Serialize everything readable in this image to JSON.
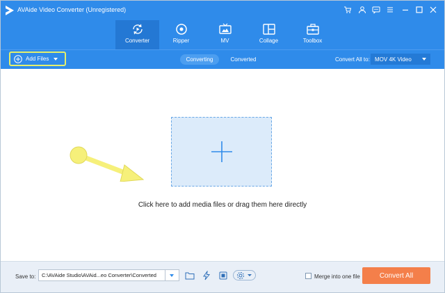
{
  "window": {
    "title": "AVAide Video Converter (Unregistered)",
    "accent_color": "#2f8bea",
    "controls": [
      "cart-icon",
      "user-icon",
      "feedback-icon",
      "menu-icon",
      "minimize-icon",
      "maximize-icon",
      "close-icon"
    ]
  },
  "tabs": [
    {
      "label": "Converter",
      "icon": "converter-icon",
      "active": true
    },
    {
      "label": "Ripper",
      "icon": "ripper-disc-icon",
      "active": false
    },
    {
      "label": "MV",
      "icon": "mv-tv-icon",
      "active": false
    },
    {
      "label": "Collage",
      "icon": "collage-grid-icon",
      "active": false
    },
    {
      "label": "Toolbox",
      "icon": "toolbox-icon",
      "active": false
    }
  ],
  "toolbar": {
    "add_files_label": "Add Files",
    "segments": [
      {
        "label": "Converting",
        "active": true
      },
      {
        "label": "Converted",
        "active": false
      }
    ],
    "convert_all_label": "Convert All to:",
    "format_value": "MOV 4K Video"
  },
  "main": {
    "drop_hint": "Click here to add media files or drag them here directly"
  },
  "bottom": {
    "save_to_label": "Save to:",
    "save_path": "C:\\AVAide Studio\\AVAid...eo Converter\\Converted",
    "merge_label": "Merge into one file",
    "merge_checked": false,
    "convert_all_button": "Convert All",
    "convert_button_color": "#f47f4a"
  }
}
